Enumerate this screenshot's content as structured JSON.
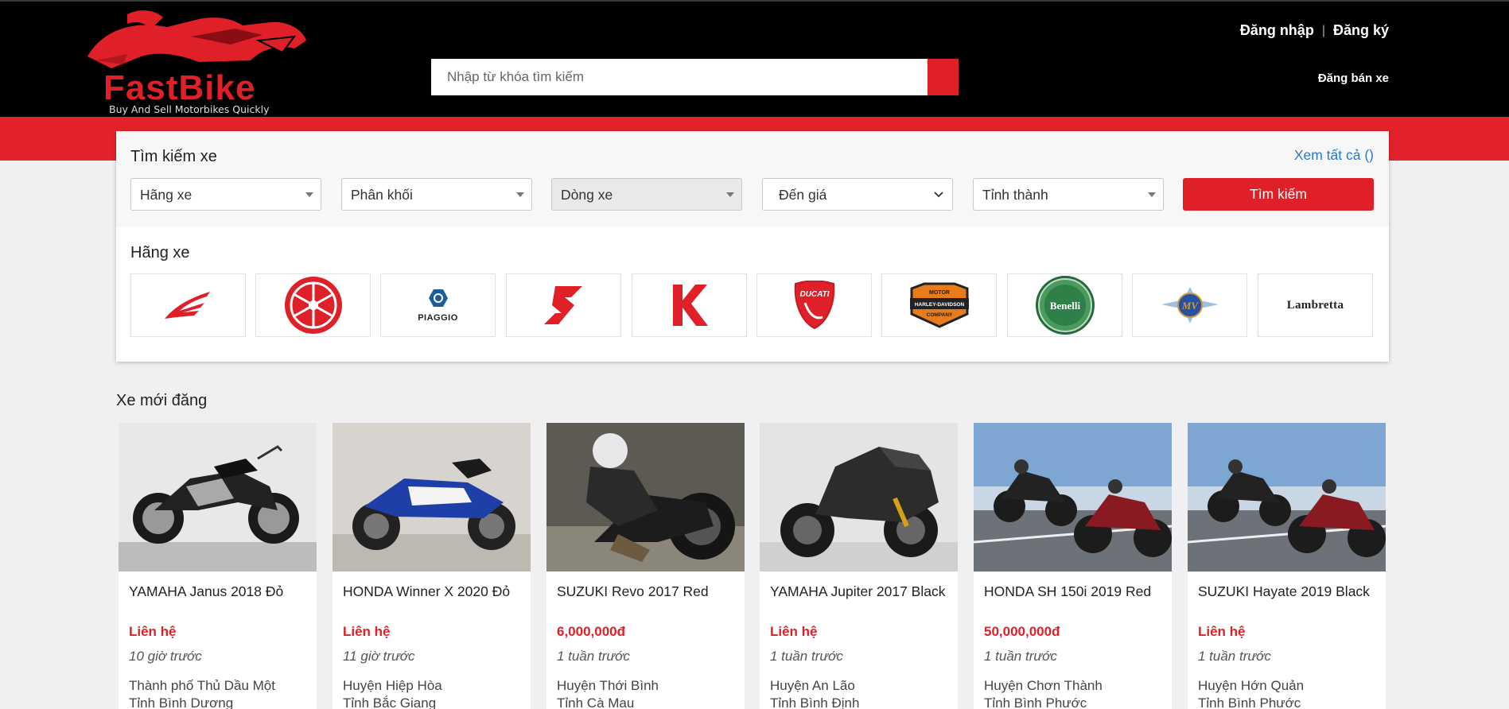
{
  "header": {
    "logo_text": "FastBike",
    "logo_tagline": "Buy And Sell Motorbikes Quickly",
    "search_placeholder": "Nhập từ khóa tìm kiếm",
    "login": "Đăng nhập",
    "separator": "|",
    "register": "Đăng ký",
    "sell": "Đăng bán xe"
  },
  "search_panel": {
    "title": "Tìm kiếm xe",
    "view_all": "Xem tất cả ()",
    "filters": {
      "brand": "Hãng xe",
      "engine": "Phân khối",
      "model": "Dòng xe",
      "price": "Đến giá",
      "province": "Tỉnh thành"
    },
    "search_button": "Tìm kiếm",
    "brands_title": "Hãng xe",
    "brands": [
      "Honda",
      "Yamaha",
      "Piaggio",
      "Suzuki",
      "Kawasaki",
      "Ducati",
      "Harley-Davidson",
      "Benelli",
      "MV Agusta",
      "Lambretta"
    ],
    "brand_logo_text": {
      "piaggio": "PIAGGIO",
      "ducati": "DUCATI",
      "harley_top": "MOTOR",
      "harley_mid": "HARLEY-DAVIDSON",
      "harley_bot": "COMPANY",
      "benelli": "Benelli",
      "mv": "MV",
      "lambretta": "Lambretta"
    }
  },
  "listings": {
    "title": "Xe mới đăng",
    "items": [
      {
        "name": "YAMAHA Janus 2018 Đỏ",
        "price": "Liên hệ",
        "time": "10 giờ trước",
        "district": "Thành phố Thủ Dầu Một",
        "province": "Tỉnh Bình Dương"
      },
      {
        "name": "HONDA Winner X 2020 Đỏ",
        "price": "Liên hệ",
        "time": "11 giờ trước",
        "district": "Huyện Hiệp Hòa",
        "province": "Tỉnh Bắc Giang"
      },
      {
        "name": "SUZUKI Revo 2017 Red",
        "price": "6,000,000đ",
        "time": "1 tuần trước",
        "district": "Huyện Thới Bình",
        "province": "Tỉnh Cà Mau"
      },
      {
        "name": "YAMAHA Jupiter 2017 Black",
        "price": "Liên hệ",
        "time": "1 tuần trước",
        "district": "Huyện An Lão",
        "province": "Tỉnh Bình Định"
      },
      {
        "name": "HONDA SH 150i 2019 Red",
        "price": "50,000,000đ",
        "time": "1 tuần trước",
        "district": "Huyện Chơn Thành",
        "province": "Tỉnh Bình Phước"
      },
      {
        "name": "SUZUKI Hayate 2019 Black",
        "price": "Liên hệ",
        "time": "1 tuần trước",
        "district": "Huyện Hớn Quản",
        "province": "Tỉnh Bình Phước"
      }
    ]
  },
  "colors": {
    "brand_red": "#e02029",
    "header_bg": "#000000",
    "link_blue": "#2a7ac8",
    "page_bg": "#f0f0f2"
  }
}
